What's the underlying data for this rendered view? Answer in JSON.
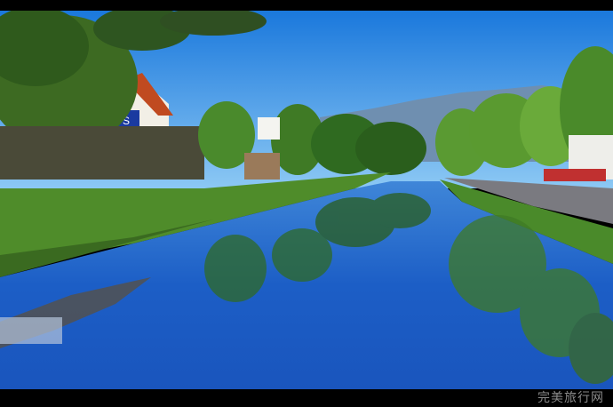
{
  "photo": {
    "subject": "canal",
    "sign_text": "PHILIPS",
    "colors": {
      "sky_top": "#1e7fe0",
      "sky_bottom": "#7fc2f4",
      "water": "#1f5fc8",
      "foliage": "#3f7a25",
      "grass": "#4f8c2a",
      "mountain": "#6f8fb0"
    }
  },
  "watermark": {
    "text": "完美旅行网"
  }
}
